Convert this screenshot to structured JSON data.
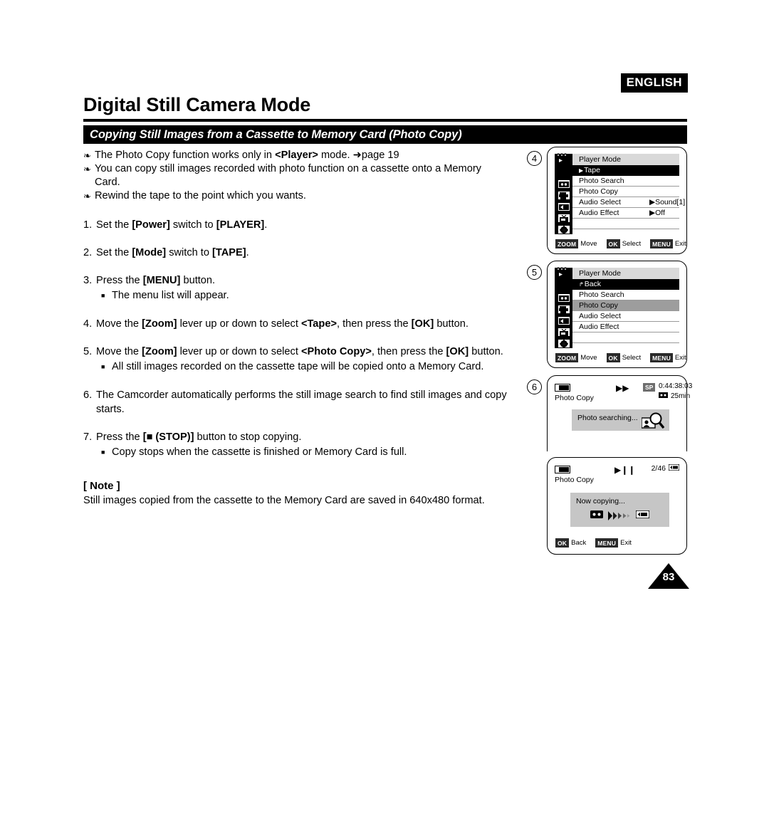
{
  "header": {
    "language_badge": "ENGLISH",
    "title": "Digital Still Camera Mode",
    "section_title": "Copying Still Images from a Cassette to Memory Card (Photo Copy)"
  },
  "bullets": [
    {
      "pre": "The Photo Copy function works only in ",
      "bold": "<Player>",
      "post": " mode. ➜page 19",
      "cont": ""
    },
    {
      "pre": "You can copy still images recorded with photo function on a cassette onto a Memory",
      "bold": "",
      "post": "",
      "cont": "Card."
    },
    {
      "pre": "Rewind the tape to the point which you wants.",
      "bold": "",
      "post": "",
      "cont": ""
    }
  ],
  "steps": [
    {
      "num": "1.",
      "parts": [
        {
          "t": "Set the ",
          "b": false
        },
        {
          "t": "[Power]",
          "b": true
        },
        {
          "t": " switch to ",
          "b": false
        },
        {
          "t": "[PLAYER]",
          "b": true
        },
        {
          "t": ".",
          "b": false
        }
      ],
      "sub": []
    },
    {
      "num": "2.",
      "parts": [
        {
          "t": "Set the ",
          "b": false
        },
        {
          "t": "[Mode]",
          "b": true
        },
        {
          "t": " switch to ",
          "b": false
        },
        {
          "t": "[TAPE]",
          "b": true
        },
        {
          "t": ".",
          "b": false
        }
      ],
      "sub": []
    },
    {
      "num": "3.",
      "parts": [
        {
          "t": "Press the ",
          "b": false
        },
        {
          "t": "[MENU]",
          "b": true
        },
        {
          "t": " button.",
          "b": false
        }
      ],
      "sub": [
        "The menu list will appear."
      ]
    },
    {
      "num": "4.",
      "parts": [
        {
          "t": "Move the ",
          "b": false
        },
        {
          "t": "[Zoom]",
          "b": true
        },
        {
          "t": " lever up or down to select ",
          "b": false
        },
        {
          "t": "<Tape>",
          "b": true
        },
        {
          "t": ", then press the ",
          "b": false
        },
        {
          "t": "[OK]",
          "b": true
        },
        {
          "t": " button.",
          "b": false
        }
      ],
      "sub": []
    },
    {
      "num": "5.",
      "parts": [
        {
          "t": "Move the ",
          "b": false
        },
        {
          "t": "[Zoom]",
          "b": true
        },
        {
          "t": " lever up or down to select ",
          "b": false
        },
        {
          "t": "<Photo Copy>",
          "b": true
        },
        {
          "t": ", then press the ",
          "b": false
        },
        {
          "t": "[OK]",
          "b": true
        },
        {
          "t": " button.",
          "b": false
        }
      ],
      "sub": [
        "All still images recorded on the cassette tape will be copied onto a Memory Card."
      ]
    },
    {
      "num": "6.",
      "parts": [
        {
          "t": "The Camcorder automatically performs the still image search to find still images and copy starts.",
          "b": false
        }
      ],
      "sub": []
    },
    {
      "num": "7.",
      "parts": [
        {
          "t": "Press the ",
          "b": false
        },
        {
          "t": "[■ (STOP)]",
          "b": true
        },
        {
          "t": " button to stop copying.",
          "b": false
        }
      ],
      "sub": [
        "Copy stops when the cassette is finished or Memory Card is full."
      ]
    }
  ],
  "note": {
    "heading": "[ Note ]",
    "text": "Still images copied from the cassette to the Memory Card are saved in 640x480 format."
  },
  "panels": {
    "panel4": {
      "step_number": "4",
      "menu_title": "Player Mode",
      "rows": [
        {
          "marker": "▶",
          "label": "Tape",
          "value": "",
          "state": "selected-black"
        },
        {
          "marker": "",
          "label": "Photo Search",
          "value": "",
          "state": "normal"
        },
        {
          "marker": "",
          "label": "Photo Copy",
          "value": "",
          "state": "normal"
        },
        {
          "marker": "",
          "label": "Audio Select",
          "value": "▶Sound[1]",
          "state": "normal"
        },
        {
          "marker": "",
          "label": "Audio Effect",
          "value": "▶Off",
          "state": "normal"
        },
        {
          "marker": "",
          "label": "",
          "value": "",
          "state": "blank"
        }
      ],
      "keys": [
        {
          "badge": "ZOOM",
          "label": "Move"
        },
        {
          "badge": "OK",
          "label": "Select"
        },
        {
          "badge": "MENU",
          "label": "Exit"
        }
      ],
      "icons": [
        "camcorder-icon",
        "tape-icon",
        "photo-copy-icon",
        "audio-icon",
        "tv-icon",
        "settings-icon"
      ]
    },
    "panel5": {
      "step_number": "5",
      "menu_title": "Player Mode",
      "rows": [
        {
          "marker": "↱",
          "label": "Back",
          "value": "",
          "state": "selected-black"
        },
        {
          "marker": "",
          "label": "Photo Search",
          "value": "",
          "state": "normal"
        },
        {
          "marker": "",
          "label": "Photo Copy",
          "value": "",
          "state": "highlighted-gray"
        },
        {
          "marker": "",
          "label": "Audio Select",
          "value": "",
          "state": "normal"
        },
        {
          "marker": "",
          "label": "Audio Effect",
          "value": "",
          "state": "normal"
        },
        {
          "marker": "",
          "label": "",
          "value": "",
          "state": "blank"
        }
      ],
      "keys": [
        {
          "badge": "ZOOM",
          "label": "Move"
        },
        {
          "badge": "OK",
          "label": "Select"
        },
        {
          "badge": "MENU",
          "label": "Exit"
        }
      ]
    },
    "panel6": {
      "step_number": "6",
      "mode_label": "Photo Copy",
      "transport_icon": "fast-forward-icon",
      "speed_badge": "SP",
      "timecode": "0:44:38:03",
      "tape_remaining": "25min",
      "osd_text": "Photo searching...",
      "osd_icon": "photo-search-magnifier-icon"
    },
    "panel7": {
      "mode_label": "Photo Copy",
      "transport_icon": "play-pause-icon",
      "counter": "2/46",
      "osd_text": "Now copying...",
      "osd_from_icon": "cassette-icon",
      "osd_to_icon": "memory-card-icon",
      "keys": [
        {
          "badge": "OK",
          "label": "Back"
        },
        {
          "badge": "MENU",
          "label": "Exit"
        }
      ]
    }
  },
  "footer": {
    "page_number": "83"
  }
}
